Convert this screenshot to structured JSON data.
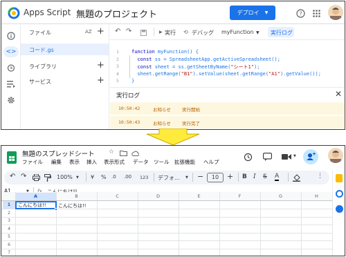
{
  "gas": {
    "app_name": "Apps Script",
    "project_title": "無題のプロジェクト",
    "deploy_label": "デプロイ",
    "files_label": "ファイル",
    "sort_label": "AZ",
    "file_name": "コード.gs",
    "libraries_label": "ライブラリ",
    "services_label": "サービス",
    "toolbar": {
      "run_label": "実行",
      "debug_label": "デバッグ",
      "function_name": "myFunction",
      "exec_log_label": "実行ログ"
    },
    "code_lines": [
      {
        "n": "1",
        "text": "function myFunction() {"
      },
      {
        "n": "2",
        "text": "  const ss = SpreadsheetApp.getActiveSpreadsheet();"
      },
      {
        "n": "3",
        "text": "  const sheet = ss.getSheetByName(\"シート1\");"
      },
      {
        "n": "4",
        "text": "  sheet.getRange(\"B1\").setValue(sheet.getRange(\"A1\").getValue());"
      },
      {
        "n": "5",
        "text": "}"
      }
    ],
    "log_panel_title": "実行ログ",
    "log_rows": [
      {
        "time": "10:50:42",
        "level": "お知らせ",
        "msg": "実行開始"
      },
      {
        "time": "10:50:43",
        "level": "お知らせ",
        "msg": "実行完了"
      }
    ]
  },
  "sheets": {
    "doc_title": "無題のスプレッドシート",
    "menu": [
      "ファイル",
      "編集",
      "表示",
      "挿入",
      "表示形式",
      "データ",
      "ツール",
      "拡張機能",
      "ヘルプ"
    ],
    "zoom": "100%",
    "currency": "¥",
    "percent": "%",
    "decimal_dec": ".0",
    "decimal_inc": ".00",
    "number_format": "123",
    "font_name": "デフォ...",
    "font_size": "10",
    "name_box": "A1",
    "fx": "fx",
    "formula_value": "こんにちは!!",
    "columns": [
      "A",
      "B",
      "C",
      "D",
      "E",
      "F",
      "G",
      "H"
    ],
    "rows": [
      "1",
      "2",
      "3",
      "4",
      "5",
      "6",
      "7"
    ],
    "cell_a1": "こんにちは!!",
    "cell_b1": "こんにちは!!"
  },
  "colors": {
    "accent": "#1a73e8",
    "log_bg": "#fef7e0",
    "arrow": "#ffeb3b",
    "sheets_green": "#0f9d58",
    "selected_bg": "#e8f0fe"
  }
}
